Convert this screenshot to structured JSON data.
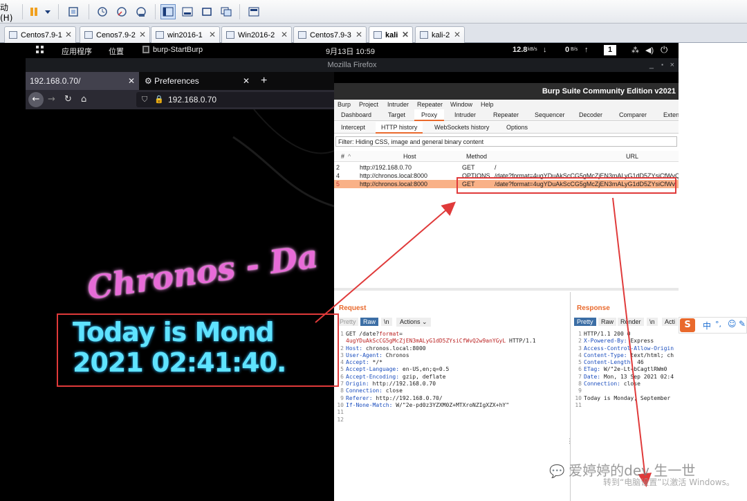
{
  "vm_toolbar": {
    "menu_label": "动(H)",
    "icons": [
      "pause-icon",
      "dropdown-icon",
      "send-keys-icon",
      "snapshot-take-icon",
      "snapshot-revert-icon",
      "snapshot-manager-icon",
      "view-normal-icon",
      "view-console-icon",
      "view-fullscreen-icon",
      "view-unity-icon",
      "thumbnail-icon"
    ]
  },
  "vm_tabs": [
    "Centos7.9-1",
    "Cenos7.9-2",
    "win2016-1",
    "Win2016-2",
    "Centos7.9-3",
    "kali",
    "kali-2"
  ],
  "kali_bar": {
    "apps": "应用程序",
    "places": "位置",
    "active_app": "burp-StartBurp",
    "clock": "9月13日 10:59",
    "net_down": "12.8",
    "net_down_unit": "kB/s",
    "net_up": "0",
    "net_up_unit": "B/s",
    "workspace": "1"
  },
  "firefox": {
    "window_title": "Mozilla Firefox",
    "tab1": "192.168.0.70/",
    "tab2": "Preferences",
    "url": "192.168.0.70",
    "page_title_art": "Chronos - Da",
    "page_line1": "Today is Mond",
    "page_line2": "2021 02:41:40."
  },
  "burp": {
    "title": "Burp Suite Community Edition v2021",
    "menu": [
      "Burp",
      "Project",
      "Intruder",
      "Repeater",
      "Window",
      "Help"
    ],
    "tabs": [
      "Dashboard",
      "Target",
      "Proxy",
      "Intruder",
      "Repeater",
      "Sequencer",
      "Decoder",
      "Comparer",
      "Exten"
    ],
    "subtabs": [
      "Intercept",
      "HTTP history",
      "WebSockets history",
      "Options"
    ],
    "filter": "Filter: Hiding CSS, image and general binary content",
    "table_headers": [
      "#",
      "Host",
      "Method",
      "URL"
    ],
    "rows": [
      {
        "num": "2",
        "host": "http://192.168.0.70",
        "method": "GET",
        "url": "/"
      },
      {
        "num": "4",
        "host": "http://chronos.local:8000",
        "method": "OPTIONS",
        "url": "/date?format=4ugYDuAkScCG5gMcZjEN3mALyG1dD5ZYsiCfWvQ"
      },
      {
        "num": "5",
        "host": "http://chronos.local:8000",
        "method": "GET",
        "url": "/date?format=4ugYDuAkScCG5gMcZjEN3mALyG1dD5ZYsiCfWv"
      }
    ],
    "request": {
      "heading": "Request",
      "buttons": [
        "Pretty",
        "Raw",
        "\\n",
        "Actions"
      ],
      "lines": [
        {
          "n": "1",
          "key": "GET /date?",
          "param": "format",
          "rest": "="
        },
        {
          "n": "",
          "key": "",
          "param": "4ugYDuAkScCG5gMcZjEN3mALyG1dD5ZYsiCfWvQ2w9anYGyL",
          "rest": " HTTP/1.1"
        },
        {
          "n": "2",
          "key": "Host:",
          "param": "",
          "rest": " chronos.local:8000"
        },
        {
          "n": "3",
          "key": "User-Agent:",
          "param": "",
          "rest": " Chronos"
        },
        {
          "n": "4",
          "key": "Accept:",
          "param": "",
          "rest": " */*"
        },
        {
          "n": "5",
          "key": "Accept-Language:",
          "param": "",
          "rest": " en-US,en;q=0.5"
        },
        {
          "n": "6",
          "key": "Accept-Encoding:",
          "param": "",
          "rest": " gzip, deflate"
        },
        {
          "n": "7",
          "key": "Origin:",
          "param": "",
          "rest": " http://192.168.0.70"
        },
        {
          "n": "8",
          "key": "Connection:",
          "param": "",
          "rest": " close"
        },
        {
          "n": "9",
          "key": "Referer:",
          "param": "",
          "rest": " http://192.168.0.70/"
        },
        {
          "n": "10",
          "key": "If-None-Match:",
          "param": "",
          "rest": " W/\"2e-pd0z3YZXM0Z+MTXroNZIgXZX+hY\""
        },
        {
          "n": "11",
          "key": "",
          "param": "",
          "rest": ""
        },
        {
          "n": "12",
          "key": "",
          "param": "",
          "rest": ""
        }
      ]
    },
    "response": {
      "heading": "Response",
      "buttons": [
        "Pretty",
        "Raw",
        "Render",
        "\\n",
        "Acti"
      ],
      "lines": [
        {
          "n": "1",
          "key": "HTTP/1.1 200 O",
          "rest": ""
        },
        {
          "n": "2",
          "key": "X-Powered-By:",
          "rest": " Express"
        },
        {
          "n": "3",
          "key": "Access-Control-Allow-Origin",
          "rest": ""
        },
        {
          "n": "4",
          "key": "Content-Type:",
          "rest": " text/html; ch"
        },
        {
          "n": "5",
          "key": "Content-Length:",
          "rest": " 46"
        },
        {
          "n": "6",
          "key": "ETag:",
          "rest": " W/\"2e-Lt+bCagtlRWm0"
        },
        {
          "n": "7",
          "key": "Date:",
          "rest": " Mon, 13 Sep 2021 02:4"
        },
        {
          "n": "8",
          "key": "Connection:",
          "rest": " close"
        },
        {
          "n": "9",
          "key": "",
          "rest": ""
        },
        {
          "n": "10",
          "key": "",
          "rest": "Today is Monday, September"
        },
        {
          "n": "11",
          "key": "",
          "rest": ""
        }
      ]
    }
  },
  "ime_bar": {
    "logo": "S",
    "lang": "中"
  },
  "watermark": {
    "brand": "爱婷婷的dev 生一世",
    "activate": "转到“电脑设置”以激活 Windows。"
  },
  "colors": {
    "neon_pink": "#e86bd8",
    "neon_cyan": "#5fe3ff",
    "burp_orange": "#e9692c",
    "highlight_row": "#f9b187",
    "annotation_red": "#e03a3a"
  }
}
